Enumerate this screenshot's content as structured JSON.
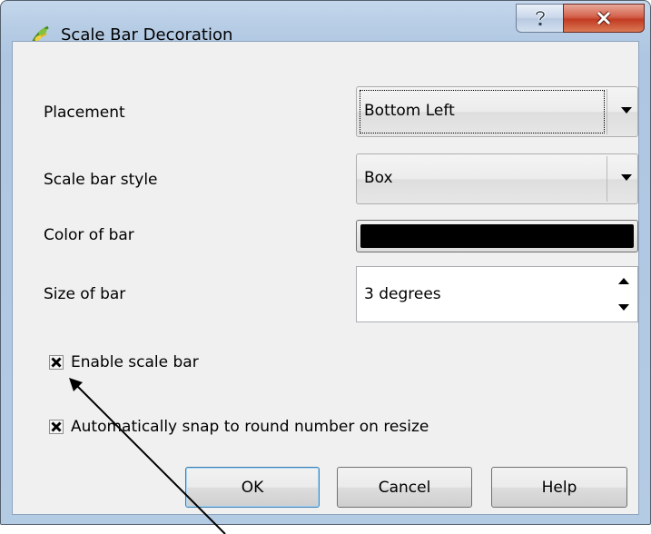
{
  "window": {
    "title": "Scale Bar Decoration",
    "help_button_glyph": "?",
    "close_button_glyph": "X"
  },
  "form": {
    "placement": {
      "label": "Placement",
      "value": "Bottom Left"
    },
    "style": {
      "label": "Scale bar style",
      "value": "Box"
    },
    "color": {
      "label": "Color of bar",
      "value": "#000000"
    },
    "size": {
      "label": "Size of bar",
      "value": "3 degrees"
    }
  },
  "checkboxes": {
    "enable": {
      "label": "Enable scale bar",
      "checked": true
    },
    "snap": {
      "label": "Automatically snap to round number on resize",
      "checked": true
    }
  },
  "buttons": {
    "ok": "OK",
    "cancel": "Cancel",
    "help": "Help"
  },
  "icons": {
    "app": "qgis-icon",
    "help": "question-icon",
    "close": "close-icon",
    "dropdown": "chevron-down-icon",
    "spin_up": "spin-up-icon",
    "spin_down": "spin-down-icon",
    "check": "x-check-icon"
  },
  "colors": {
    "close_button": "#c23b22",
    "bar_color": "#000000",
    "dialog_bg": "#f0f0f0"
  },
  "annotation": {
    "type": "arrow",
    "points_to": "Enable scale bar checkbox"
  }
}
